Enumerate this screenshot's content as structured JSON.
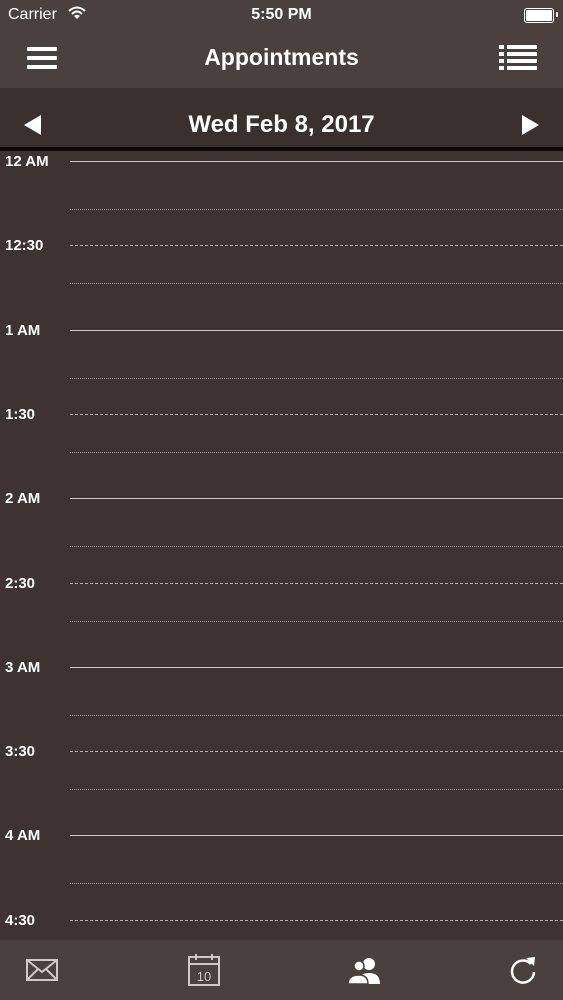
{
  "status_bar": {
    "carrier": "Carrier",
    "time": "5:50 PM",
    "battery_level": 1.0
  },
  "nav_bar": {
    "title": "Appointments",
    "left_icon": "hamburger-menu-icon",
    "right_icon": "list-view-icon"
  },
  "date_bar": {
    "date": "Wed Feb 8, 2017",
    "prev_icon": "arrow-left-icon",
    "next_icon": "arrow-right-icon"
  },
  "timeline": {
    "slots": [
      {
        "label": "12 AM"
      },
      {
        "label": "12:30"
      },
      {
        "label": "1 AM"
      },
      {
        "label": "1:30"
      },
      {
        "label": "2 AM"
      },
      {
        "label": "2:30"
      },
      {
        "label": "3 AM"
      },
      {
        "label": "3:30"
      },
      {
        "label": "4 AM"
      },
      {
        "label": "4:30"
      }
    ]
  },
  "tab_bar": {
    "items": [
      {
        "icon": "mail-icon"
      },
      {
        "icon": "calendar-icon",
        "badge": "10"
      },
      {
        "icon": "contacts-icon"
      },
      {
        "icon": "refresh-icon"
      }
    ]
  },
  "colors": {
    "background": "#3e3330",
    "bar": "#4a403d",
    "text": "#ffffff"
  }
}
